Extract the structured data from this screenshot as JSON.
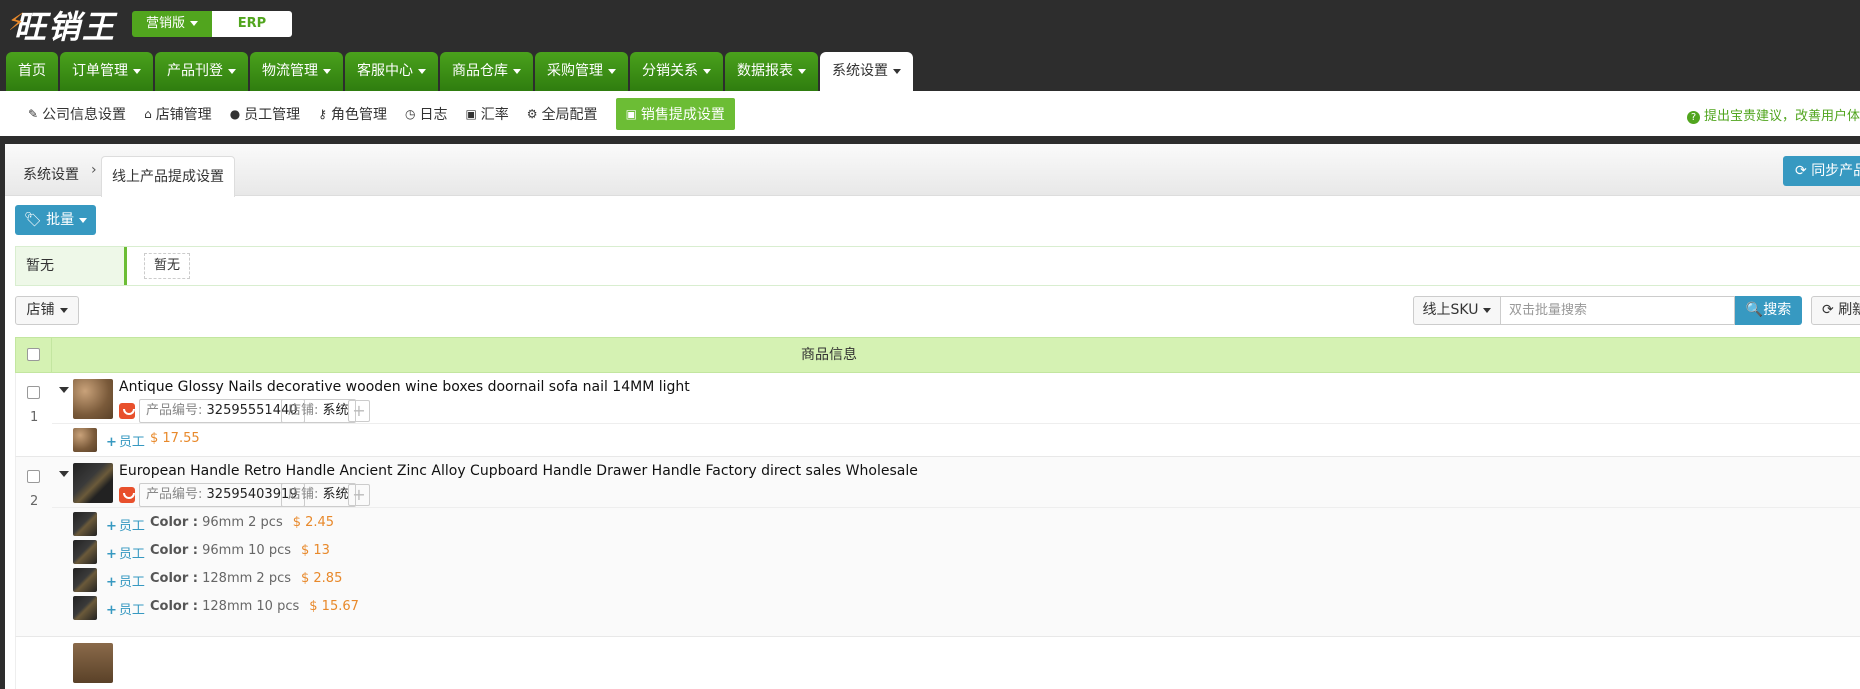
{
  "app": {
    "logo_text": "旺销王",
    "edition_label": "营销版",
    "erp_label": "ERP"
  },
  "nav": {
    "tabs": [
      {
        "label": "首页",
        "dropdown": false
      },
      {
        "label": "订单管理",
        "dropdown": true
      },
      {
        "label": "产品刊登",
        "dropdown": true
      },
      {
        "label": "物流管理",
        "dropdown": true
      },
      {
        "label": "客服中心",
        "dropdown": true
      },
      {
        "label": "商品仓库",
        "dropdown": true
      },
      {
        "label": "采购管理",
        "dropdown": true
      },
      {
        "label": "分销关系",
        "dropdown": true
      },
      {
        "label": "数据报表",
        "dropdown": true
      },
      {
        "label": "系统设置",
        "dropdown": true,
        "active": true
      }
    ]
  },
  "subnav": {
    "items": [
      {
        "label": "公司信息设置",
        "icon": "edit-icon"
      },
      {
        "label": "店铺管理",
        "icon": "home-icon"
      },
      {
        "label": "员工管理",
        "icon": "user-icon"
      },
      {
        "label": "角色管理",
        "icon": "key-icon"
      },
      {
        "label": "日志",
        "icon": "clock-icon"
      },
      {
        "label": "汇率",
        "icon": "money-icon"
      },
      {
        "label": "全局配置",
        "icon": "gear-icon"
      },
      {
        "label": "销售提成设置",
        "icon": "money-icon",
        "active": true
      }
    ],
    "suggest_text": "提出宝贵建议，改善用户体"
  },
  "breadcrumb": {
    "root": "系统设置",
    "current": "线上产品提成设置"
  },
  "toolbar": {
    "sync_label": "同步产品",
    "batch_label": "批量",
    "filter_label": "暂无",
    "filter_chip": "暂无",
    "shop_label": "店铺",
    "sku_select": "线上SKU",
    "search_placeholder": "双击批量搜索",
    "search_label": "搜索",
    "refresh_label": "刷新"
  },
  "table": {
    "header": "商品信息",
    "products": [
      {
        "index": "1",
        "title": "Antique Glossy Nails decorative wooden wine boxes doornail sofa nail 14MM light",
        "product_no_label": "产品编号:",
        "product_no": "32595551440",
        "shop_label": "店铺:",
        "shop": "系统",
        "variants": [
          {
            "staff": "员工",
            "attr_key": "",
            "attr_value": "",
            "price": "$ 17.55"
          }
        ]
      },
      {
        "index": "2",
        "title": "European Handle Retro Handle Ancient Zinc Alloy Cupboard Handle Drawer Handle Factory direct sales Wholesale",
        "product_no_label": "产品编号:",
        "product_no": "32595403919",
        "shop_label": "店铺:",
        "shop": "系统",
        "variants": [
          {
            "staff": "员工",
            "attr_key": "Color :",
            "attr_value": "96mm 2 pcs",
            "price": "$ 2.45"
          },
          {
            "staff": "员工",
            "attr_key": "Color :",
            "attr_value": "96mm 10 pcs",
            "price": "$ 13"
          },
          {
            "staff": "员工",
            "attr_key": "Color :",
            "attr_value": "128mm 2 pcs",
            "price": "$ 2.85"
          },
          {
            "staff": "员工",
            "attr_key": "Color :",
            "attr_value": "128mm 10 pcs",
            "price": "$ 15.67"
          }
        ]
      }
    ]
  },
  "colors": {
    "brand_green": "#51a51e",
    "accent_blue": "#3799c1",
    "price_orange": "#e8892b",
    "table_header_bg": "#d5f2b3"
  }
}
